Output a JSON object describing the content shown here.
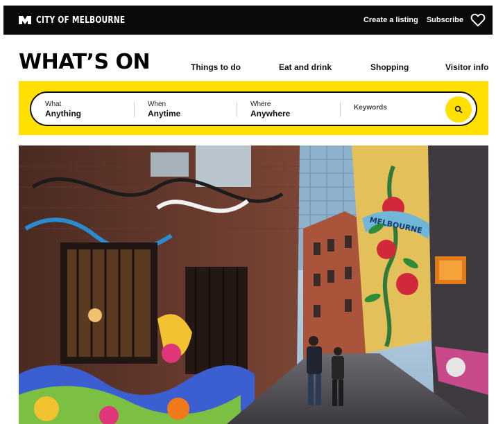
{
  "header": {
    "brand": "CITY OF MELBOURNE",
    "links": {
      "create_listing": "Create a listing",
      "subscribe": "Subscribe"
    },
    "favourites_icon": "heart-icon"
  },
  "page": {
    "title": "WHAT’S ON"
  },
  "nav": {
    "items": [
      "Things to do",
      "Eat and drink",
      "Shopping",
      "Visitor info"
    ]
  },
  "search": {
    "what": {
      "label": "What",
      "value": "Anything"
    },
    "when": {
      "label": "When",
      "value": "Anytime"
    },
    "where": {
      "label": "Where",
      "value": "Anywhere"
    },
    "keywords_placeholder": "Keywords",
    "button_icon": "search-icon"
  },
  "hero": {
    "image": "Graffiti laneway with two pedestrians",
    "mural_text": "MELBOURNE"
  },
  "colors": {
    "accent": "#ffe000",
    "topbar": "#0a0a0a"
  }
}
